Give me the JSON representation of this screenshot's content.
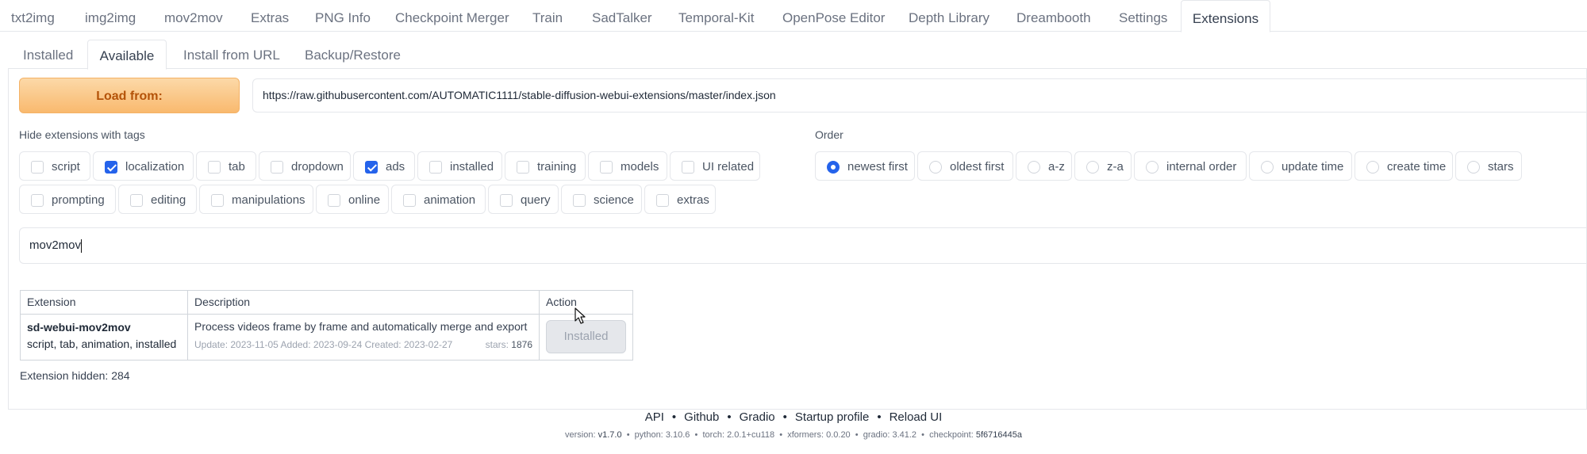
{
  "top_tabs": [
    "txt2img",
    "img2img",
    "mov2mov",
    "Extras",
    "PNG Info",
    "Checkpoint Merger",
    "Train",
    "SadTalker",
    "Temporal-Kit",
    "OpenPose Editor",
    "Depth Library",
    "Dreambooth",
    "Settings",
    "Extensions"
  ],
  "top_tab_active": "Extensions",
  "sub_tabs": [
    "Installed",
    "Available",
    "Install from URL",
    "Backup/Restore"
  ],
  "sub_tab_active": "Available",
  "load": {
    "button_label": "Load from:",
    "url": "https://raw.githubusercontent.com/AUTOMATIC1111/stable-diffusion-webui-extensions/master/index.json"
  },
  "hide_tags": {
    "label": "Hide extensions with tags",
    "row1": [
      {
        "label": "script",
        "checked": false
      },
      {
        "label": "localization",
        "checked": true
      },
      {
        "label": "tab",
        "checked": false
      },
      {
        "label": "dropdown",
        "checked": false
      },
      {
        "label": "ads",
        "checked": true
      },
      {
        "label": "installed",
        "checked": false
      },
      {
        "label": "training",
        "checked": false
      },
      {
        "label": "models",
        "checked": false
      },
      {
        "label": "UI related",
        "checked": false
      }
    ],
    "row2": [
      {
        "label": "prompting",
        "checked": false
      },
      {
        "label": "editing",
        "checked": false
      },
      {
        "label": "manipulations",
        "checked": false
      },
      {
        "label": "online",
        "checked": false
      },
      {
        "label": "animation",
        "checked": false
      },
      {
        "label": "query",
        "checked": false
      },
      {
        "label": "science",
        "checked": false
      },
      {
        "label": "extras",
        "checked": false
      }
    ]
  },
  "order": {
    "label": "Order",
    "options": [
      {
        "label": "newest first",
        "selected": true
      },
      {
        "label": "oldest first",
        "selected": false
      },
      {
        "label": "a-z",
        "selected": false
      },
      {
        "label": "z-a",
        "selected": false
      },
      {
        "label": "internal order",
        "selected": false
      },
      {
        "label": "update time",
        "selected": false
      },
      {
        "label": "create time",
        "selected": false
      },
      {
        "label": "stars",
        "selected": false
      }
    ]
  },
  "search": {
    "value": "mov2mov"
  },
  "table": {
    "headers": {
      "extension": "Extension",
      "description": "Description",
      "action": "Action"
    },
    "rows": [
      {
        "name": "sd-webui-mov2mov",
        "tags": "script, tab, animation, installed",
        "description": "Process videos frame by frame and automatically merge and export",
        "meta": "Update: 2023-11-05 Added: 2023-09-24 Created: 2023-02-27",
        "stars_label": "stars:",
        "stars": "1876",
        "action_label": "Installed"
      }
    ]
  },
  "hidden_note": "Extension hidden: 284",
  "footer": {
    "links": [
      "API",
      "Github",
      "Gradio",
      "Startup profile",
      "Reload UI"
    ],
    "version_items": [
      {
        "key": "version:",
        "value": "v1.7.0"
      },
      {
        "key": "python:",
        "value": "3.10.6"
      },
      {
        "key": "torch:",
        "value": "2.0.1+cu118"
      },
      {
        "key": "xformers:",
        "value": "0.0.20"
      },
      {
        "key": "gradio:",
        "value": "3.41.2"
      },
      {
        "key": "checkpoint:",
        "value": "5f6716445a"
      }
    ]
  },
  "colors": {
    "accent": "#2563eb",
    "load_button": "#f9b96e",
    "load_text": "#b45309"
  }
}
